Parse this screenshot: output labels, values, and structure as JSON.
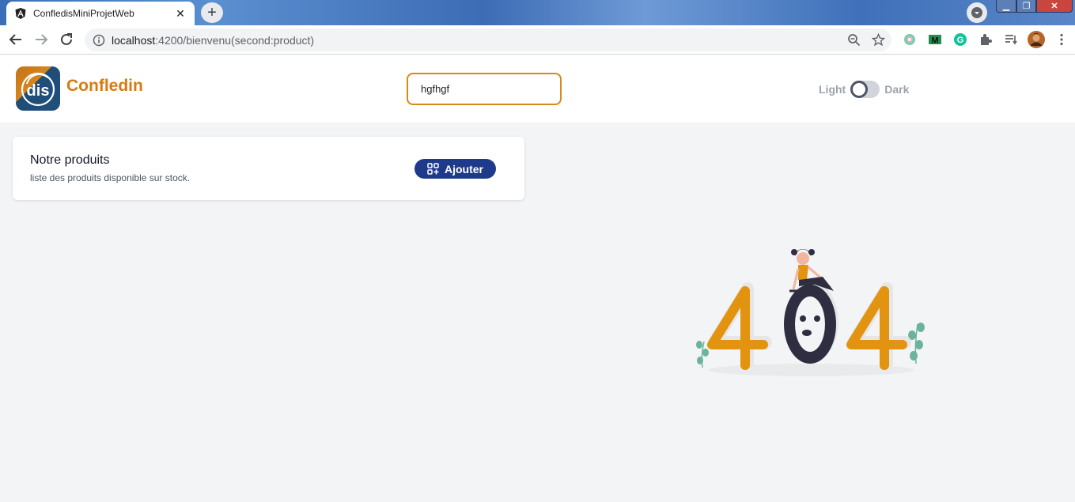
{
  "browser": {
    "tab_title": "ConfledisMiniProjetWeb",
    "tab_close": "✕",
    "new_tab": "+",
    "url_host": "localhost",
    "url_path": ":4200/bienvenu(second:product)",
    "window_minimize": "▁",
    "window_maximize": "❐",
    "window_close": "✕"
  },
  "header": {
    "brand": "Confledin",
    "search_value": "hgfhgf",
    "theme_light_label": "Light",
    "theme_dark_label": "Dark"
  },
  "card": {
    "title": "Notre produits",
    "subtitle": "liste des produits disponible sur stock.",
    "add_button": "Ajouter"
  },
  "illustration": {
    "text": "404"
  },
  "colors": {
    "accent_orange": "#d97a10",
    "button_blue": "#1e3a8a",
    "page_bg": "#f3f4f6"
  }
}
